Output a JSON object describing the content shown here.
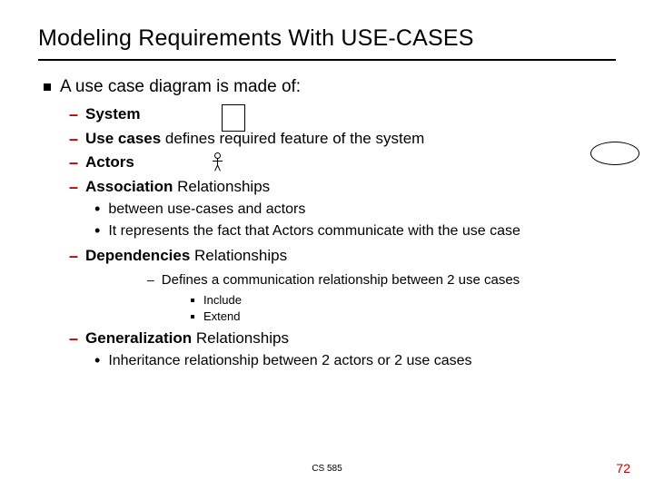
{
  "title": "Modeling Requirements With  USE-CASES",
  "main": "A use case diagram is made of:",
  "items": {
    "system": {
      "label": "System",
      "rest": ""
    },
    "usecases": {
      "label": "Use cases",
      "rest": " defines required feature of the system"
    },
    "actors": {
      "label": "Actors",
      "rest": ""
    },
    "assoc": {
      "label": "Association",
      "rest": " Relationships",
      "sub": [
        "between use-cases and actors",
        "It represents the fact that Actors communicate with the use case"
      ]
    },
    "deps": {
      "label": "Dependencies",
      "rest": " Relationships",
      "sub4": "Defines a communication relationship between 2 use cases",
      "sub5": [
        "Include",
        "Extend"
      ]
    },
    "gen": {
      "label": "Generalization",
      "rest": " Relationships",
      "sub": [
        "Inheritance relationship between 2 actors or 2 use cases"
      ]
    }
  },
  "footer": {
    "course": "CS 585",
    "page": "72"
  }
}
